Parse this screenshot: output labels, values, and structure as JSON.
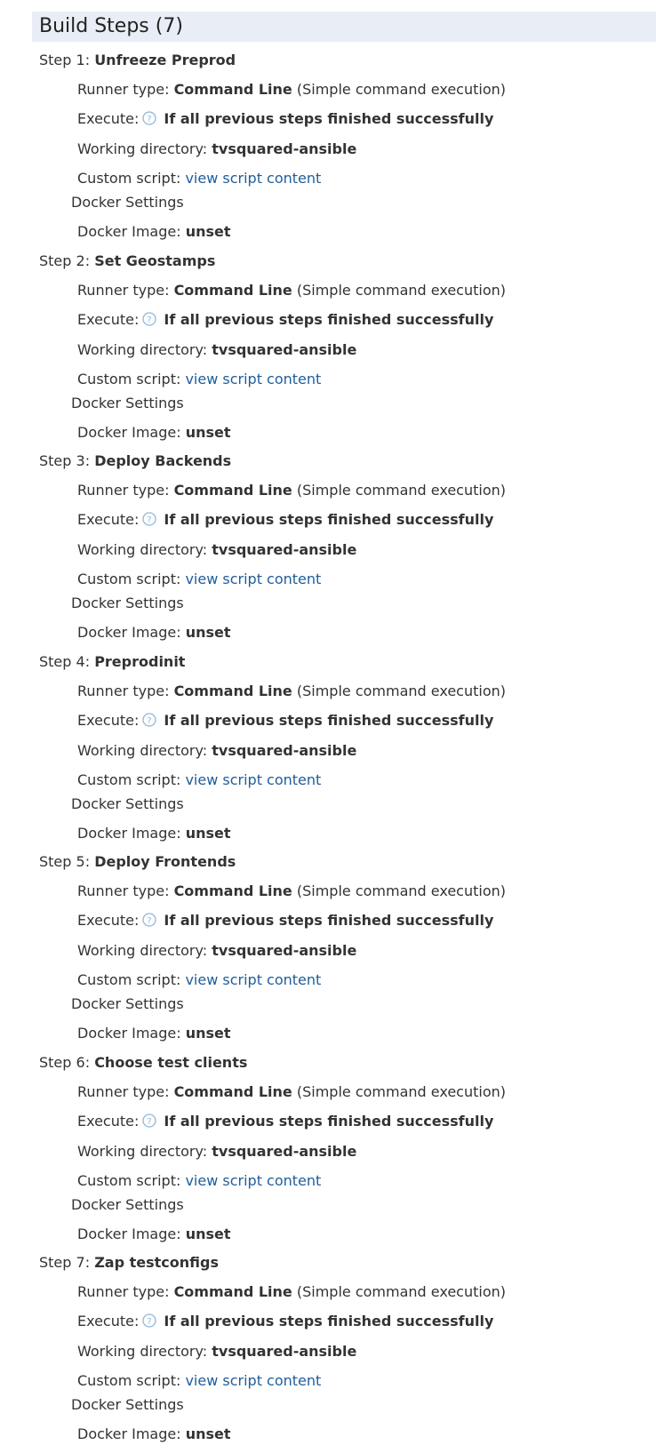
{
  "header": {
    "title": "Build Steps (7)"
  },
  "labels": {
    "runner_type": "Runner type:",
    "execute": "Execute:",
    "working_directory": "Working directory:",
    "custom_script": "Custom script:",
    "docker_settings": "Docker Settings",
    "docker_image": "Docker Image:"
  },
  "icons": {
    "help": "help-circle-icon"
  },
  "colors": {
    "header_bg": "#e9eef6",
    "link": "#1f5d99",
    "help_icon": "#8fb6d9"
  },
  "steps": [
    {
      "prefix": "Step 1:",
      "name": "Unfreeze Preprod",
      "runner_type": "Command Line",
      "runner_desc": "(Simple command execution)",
      "execute": "If all previous steps finished successfully",
      "working_directory": "tvsquared-ansible",
      "custom_script_link": "view script content",
      "docker_image": "unset"
    },
    {
      "prefix": "Step 2:",
      "name": "Set Geostamps",
      "runner_type": "Command Line",
      "runner_desc": "(Simple command execution)",
      "execute": "If all previous steps finished successfully",
      "working_directory": "tvsquared-ansible",
      "custom_script_link": "view script content",
      "docker_image": "unset"
    },
    {
      "prefix": "Step 3:",
      "name": "Deploy Backends",
      "runner_type": "Command Line",
      "runner_desc": "(Simple command execution)",
      "execute": "If all previous steps finished successfully",
      "working_directory": "tvsquared-ansible",
      "custom_script_link": "view script content",
      "docker_image": "unset"
    },
    {
      "prefix": "Step 4:",
      "name": "Preprodinit",
      "runner_type": "Command Line",
      "runner_desc": "(Simple command execution)",
      "execute": "If all previous steps finished successfully",
      "working_directory": "tvsquared-ansible",
      "custom_script_link": "view script content",
      "docker_image": "unset"
    },
    {
      "prefix": "Step 5:",
      "name": "Deploy Frontends",
      "runner_type": "Command Line",
      "runner_desc": "(Simple command execution)",
      "execute": "If all previous steps finished successfully",
      "working_directory": "tvsquared-ansible",
      "custom_script_link": "view script content",
      "docker_image": "unset"
    },
    {
      "prefix": "Step 6:",
      "name": "Choose test clients",
      "runner_type": "Command Line",
      "runner_desc": "(Simple command execution)",
      "execute": "If all previous steps finished successfully",
      "working_directory": "tvsquared-ansible",
      "custom_script_link": "view script content",
      "docker_image": "unset"
    },
    {
      "prefix": "Step 7:",
      "name": "Zap testconfigs",
      "runner_type": "Command Line",
      "runner_desc": "(Simple command execution)",
      "execute": "If all previous steps finished successfully",
      "working_directory": "tvsquared-ansible",
      "custom_script_link": "view script content",
      "docker_image": "unset"
    }
  ]
}
